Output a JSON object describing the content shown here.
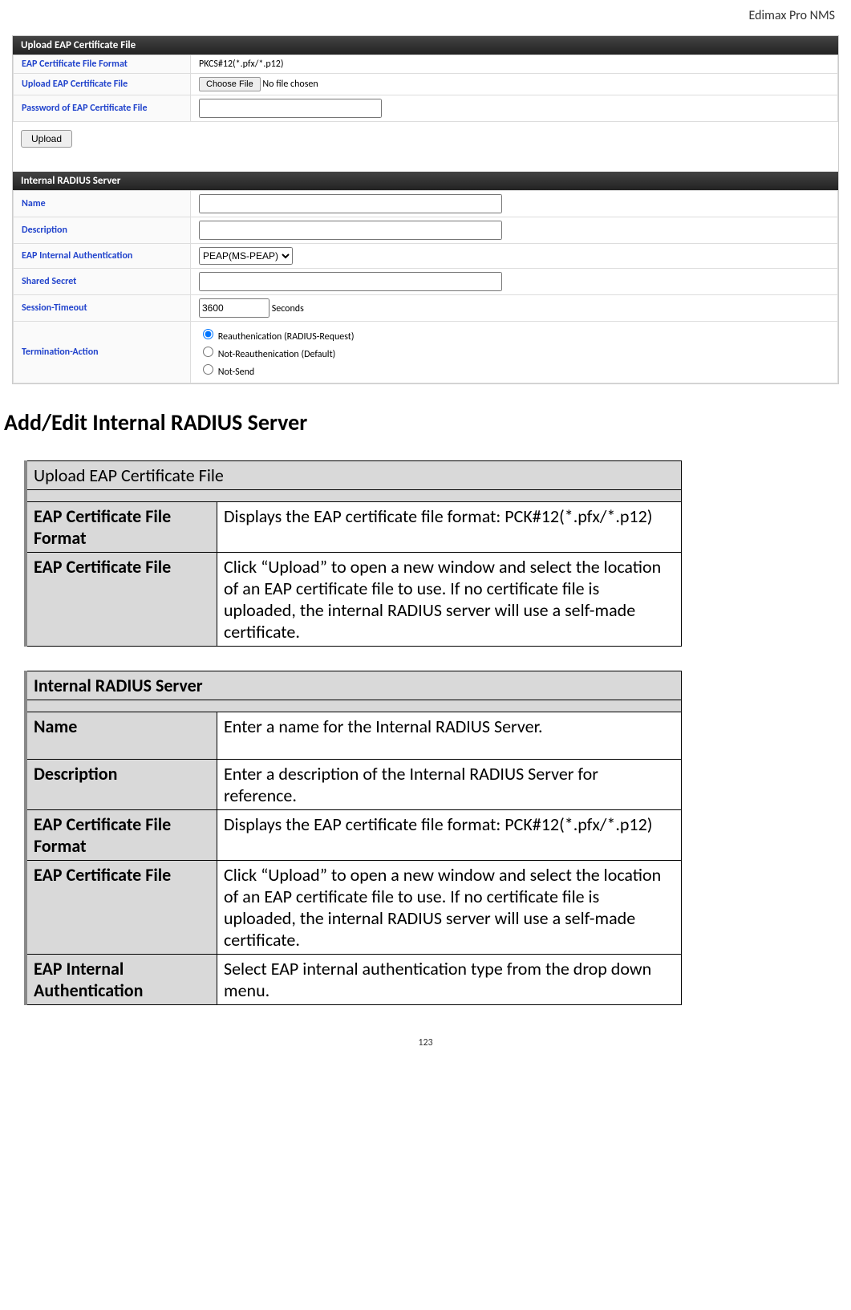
{
  "header": {
    "product": "Edimax Pro NMS"
  },
  "screenshot": {
    "upload_section": {
      "title": "Upload EAP Certificate File",
      "rows": {
        "format_label": "EAP Certificate File Format",
        "format_value": "PKCS#12(*.pfx/*.p12)",
        "upload_label": "Upload EAP Certificate File",
        "choose_file": "Choose File",
        "no_file": "No file chosen",
        "password_label": "Password of EAP Certificate File"
      },
      "upload_button": "Upload"
    },
    "radius_section": {
      "title": "Internal RADIUS Server",
      "rows": {
        "name_label": "Name",
        "desc_label": "Description",
        "eap_auth_label": "EAP Internal Authentication",
        "eap_auth_value": "PEAP(MS-PEAP)",
        "shared_label": "Shared Secret",
        "session_label": "Session-Timeout",
        "session_value": "3600",
        "session_unit": "Seconds",
        "term_label": "Termination-Action",
        "radio1": "Reauthenication (RADIUS-Request)",
        "radio2": "Not-Reauthenication (Default)",
        "radio3": "Not-Send"
      }
    }
  },
  "main_heading": "Add/Edit Internal RADIUS Server",
  "table1": {
    "title": "Upload EAP Certificate File",
    "rows": [
      {
        "label": "EAP Certificate File Format",
        "desc": "Displays the EAP certificate file format: PCK#12(*.pfx/*.p12)"
      },
      {
        "label": "EAP Certificate File",
        "desc": "Click “Upload” to open a new window and select the location of an EAP certificate file to use. If no certificate file is uploaded, the internal RADIUS server will use a self-made certificate."
      }
    ]
  },
  "table2": {
    "title": "Internal RADIUS Server",
    "rows": [
      {
        "label": "Name",
        "desc": "Enter a name for the Internal RADIUS Server."
      },
      {
        "label": "Description",
        "desc": "Enter a description of the Internal RADIUS Server for reference."
      },
      {
        "label": "EAP Certificate File Format",
        "desc": "Displays the EAP certificate file format: PCK#12(*.pfx/*.p12)"
      },
      {
        "label": "EAP Certificate File",
        "desc": "Click “Upload” to open a new window and select the location of an EAP certificate file to use. If no certificate file is uploaded, the internal RADIUS server will use a self-made certificate."
      },
      {
        "label": "EAP Internal Authentication",
        "desc": "Select EAP internal authentication type from the drop down menu."
      }
    ]
  },
  "page_number": "123"
}
